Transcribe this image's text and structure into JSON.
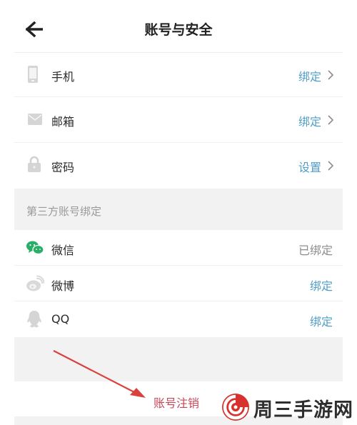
{
  "header": {
    "title": "账号与安全",
    "back_icon": "arrow-left-icon"
  },
  "account_rows": [
    {
      "icon": "phone-icon",
      "label": "手机",
      "action": "绑定"
    },
    {
      "icon": "envelope-icon",
      "label": "邮箱",
      "action": "绑定"
    },
    {
      "icon": "lock-icon",
      "label": "密码",
      "action": "设置"
    }
  ],
  "third_party": {
    "section_title": "第三方账号绑定",
    "items": [
      {
        "icon": "wechat-icon",
        "label": "微信",
        "status": "已绑定"
      },
      {
        "icon": "weibo-icon",
        "label": "微博",
        "action": "绑定"
      },
      {
        "icon": "qq-icon",
        "label": "QQ",
        "action": "绑定"
      }
    ]
  },
  "logout": {
    "label": "账号注销"
  },
  "watermark": {
    "text": "周三手游网",
    "icon": "swirl-logo-icon"
  },
  "colors": {
    "accent": "#4f9fc8",
    "logout": "#c4485a",
    "annotation_arrow": "#d9413f",
    "wechat": "#2aae67",
    "watermark_logo": "#d8322f",
    "section_bg": "#f2f2f2"
  }
}
